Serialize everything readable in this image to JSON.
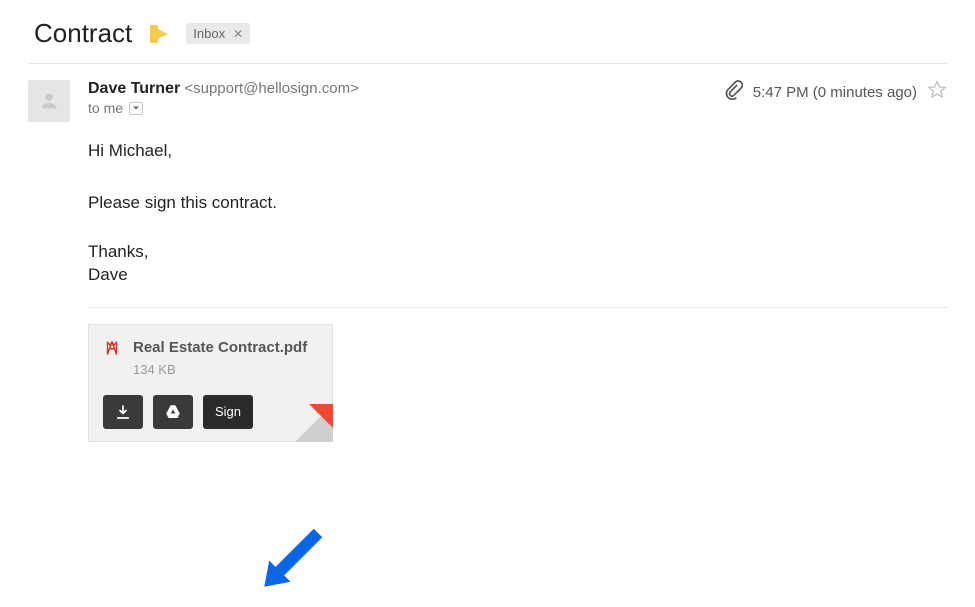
{
  "subject": "Contract",
  "label": {
    "name": "Inbox"
  },
  "sender": {
    "name": "Dave Turner",
    "email": "<support@hellosign.com>",
    "recipient_line": "to me"
  },
  "meta": {
    "time": "5:47 PM (0 minutes ago)"
  },
  "body": {
    "greeting": "Hi Michael,",
    "line1": "Please sign this contract.",
    "signoff1": "Thanks,",
    "signoff2": "Dave"
  },
  "attachment": {
    "filename": "Real Estate Contract.pdf",
    "size": "134 KB",
    "sign_label": "Sign"
  }
}
